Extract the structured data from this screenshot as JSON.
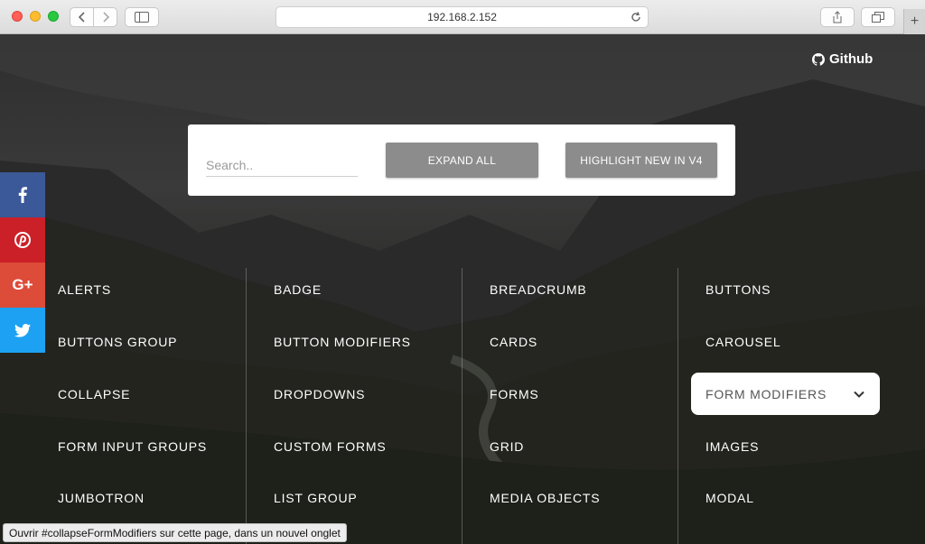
{
  "browser": {
    "url": "192.168.2.152",
    "new_tab_label": "+"
  },
  "header": {
    "github_label": "Github"
  },
  "search": {
    "placeholder": "Search..",
    "expand_all_label": "EXPAND ALL",
    "highlight_label": "HIGHLIGHT NEW IN V4"
  },
  "social": {
    "facebook": "f",
    "pinterest": "P",
    "googleplus": "G+",
    "twitter": "t"
  },
  "components": [
    [
      "ALERTS",
      "BADGE",
      "BREADCRUMB",
      "BUTTONS"
    ],
    [
      "BUTTONS GROUP",
      "BUTTON MODIFIERS",
      "CARDS",
      "CAROUSEL"
    ],
    [
      "COLLAPSE",
      "DROPDOWNS",
      "FORMS",
      "FORM MODIFIERS"
    ],
    [
      "FORM INPUT GROUPS",
      "CUSTOM FORMS",
      "GRID",
      "IMAGES"
    ],
    [
      "JUMBOTRON",
      "LIST GROUP",
      "MEDIA OBJECTS",
      "MODAL"
    ]
  ],
  "status_bar": "Ouvrir #collapseFormModifiers sur cette page, dans un nouvel onglet",
  "colors": {
    "facebook": "#3b5998",
    "pinterest": "#cb2027",
    "googleplus": "#dd4b39",
    "twitter": "#1da1f2",
    "button": "#8c8c8c"
  }
}
